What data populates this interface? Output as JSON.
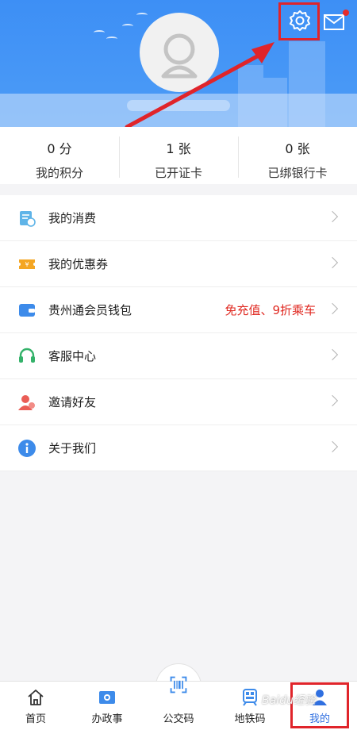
{
  "header": {
    "settings_icon": "gear-icon",
    "message_icon": "mail-icon",
    "unread_dot_color": "#e52b2b",
    "background_color": "#4d9cf7"
  },
  "stats": [
    {
      "value": "0 分",
      "label": "我的积分"
    },
    {
      "value": "1 张",
      "label": "已开证卡"
    },
    {
      "value": "0 张",
      "label": "已绑银行卡"
    }
  ],
  "menu": [
    {
      "icon": "consumption-icon",
      "label": "我的消费",
      "promo": ""
    },
    {
      "icon": "coupon-icon",
      "label": "我的优惠券",
      "promo": ""
    },
    {
      "icon": "wallet-icon",
      "label": "贵州通会员钱包",
      "promo": "免充值、9折乘车"
    },
    {
      "icon": "headset-icon",
      "label": "客服中心",
      "promo": ""
    },
    {
      "icon": "invite-icon",
      "label": "邀请好友",
      "promo": ""
    },
    {
      "icon": "info-icon",
      "label": "关于我们",
      "promo": ""
    }
  ],
  "tabbar": [
    {
      "icon": "home-icon",
      "label": "首页"
    },
    {
      "icon": "government-icon",
      "label": "办政事"
    },
    {
      "icon": "scan-icon",
      "label": "公交码"
    },
    {
      "icon": "metro-icon",
      "label": "地铁码"
    },
    {
      "icon": "user-icon",
      "label": "我的"
    }
  ],
  "watermark": "Baidu经验",
  "annotation_color": "#e0242a"
}
